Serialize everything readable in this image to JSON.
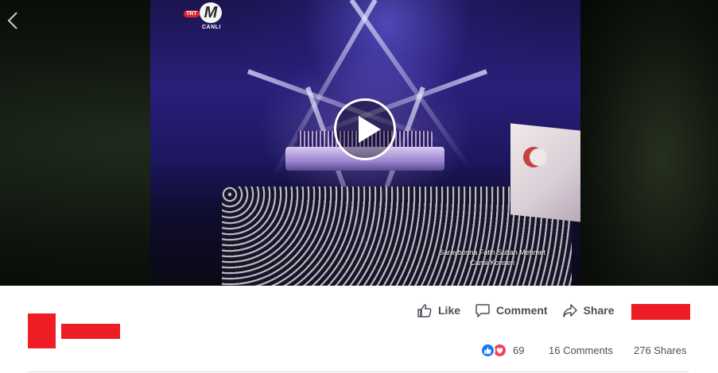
{
  "video": {
    "channel_logo_prefix": "TRT",
    "channel_logo_letter": "M",
    "channel_live_label": "CANLI",
    "caption_line1": "Saraybosna Fatih Sultan Mehmet",
    "caption_line2": "Camii Konseri"
  },
  "actions": {
    "like_label": "Like",
    "comment_label": "Comment",
    "share_label": "Share"
  },
  "stats": {
    "reactions_count": "69",
    "comments_text": "16 Comments",
    "shares_text": "276 Shares"
  },
  "icons": {
    "back": "chevron-left-icon",
    "play": "play-icon",
    "like": "thumbs-up-icon",
    "comment": "comment-bubble-icon",
    "share": "share-arrow-icon",
    "like_reaction": "like-reaction-icon",
    "love_reaction": "love-reaction-icon"
  },
  "colors": {
    "redaction": "#ee1c25",
    "facebook_blue": "#1877f2",
    "love_red": "#f33e58",
    "action_text": "#4b4f56"
  }
}
